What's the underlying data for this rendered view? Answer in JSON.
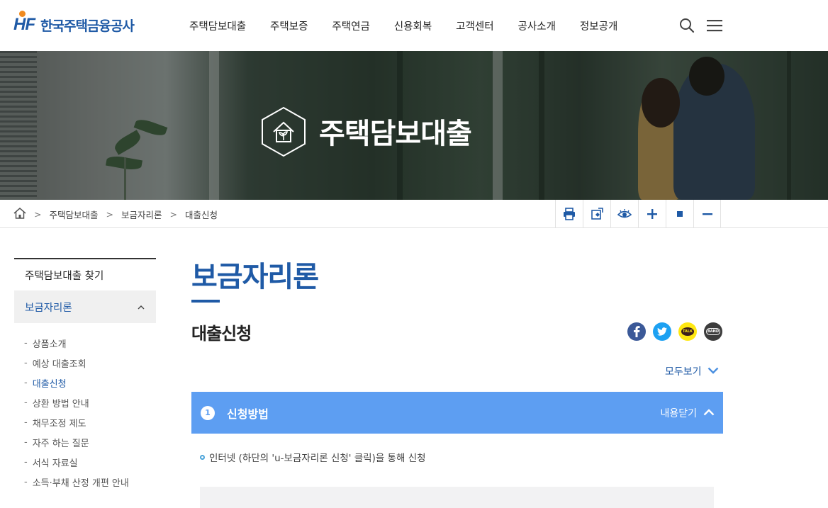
{
  "header": {
    "logo_mark": "HF",
    "logo_text": "한국주택금융공사",
    "nav": [
      "주택담보대출",
      "주택보증",
      "주택연금",
      "신용회복",
      "고객센터",
      "공사소개",
      "정보공개"
    ],
    "icons": [
      "search-icon",
      "menu-icon"
    ]
  },
  "banner": {
    "title": "주택담보대출",
    "icon": "house-sprout-icon"
  },
  "breadcrumb": {
    "home_icon": "home-icon",
    "items": [
      "주택담보대출",
      "보금자리론",
      "대출신청"
    ],
    "separator": ">"
  },
  "tools": [
    "print-icon",
    "screen-capture-icon",
    "view-icon",
    "zoom-in-icon",
    "zoom-reset-icon",
    "zoom-out-icon"
  ],
  "sidebar": {
    "top": "주택담보대출 찾기",
    "active": "보금자리론",
    "items": [
      {
        "label": "상품소개"
      },
      {
        "label": "예상 대출조회"
      },
      {
        "label": "대출신청"
      },
      {
        "label": "상환 방법 안내"
      },
      {
        "label": "채무조정 제도"
      },
      {
        "label": "자주 하는 질문"
      },
      {
        "label": "서식 자료실"
      },
      {
        "label": "소득·부채 산정 개편 안내"
      }
    ],
    "current_index": 2
  },
  "content": {
    "page_title": "보금자리론",
    "sub_title": "대출신청",
    "share": [
      "facebook-icon",
      "twitter-icon",
      "kakaotalk-icon",
      "band-icon"
    ],
    "share_talk": "TALK",
    "share_band": "BAND",
    "expand_all": "모두보기",
    "accordion": {
      "number": "1",
      "title": "신청방법",
      "toggle": "내용닫기",
      "bullet": "인터넷 (하단의 'u-보금자리론 신청' 클릭)을 통해 신청"
    }
  },
  "colors": {
    "brand_blue": "#1f5aa6",
    "accordion_blue": "#5d9ef2",
    "logo_orange": "#f08a1f"
  }
}
